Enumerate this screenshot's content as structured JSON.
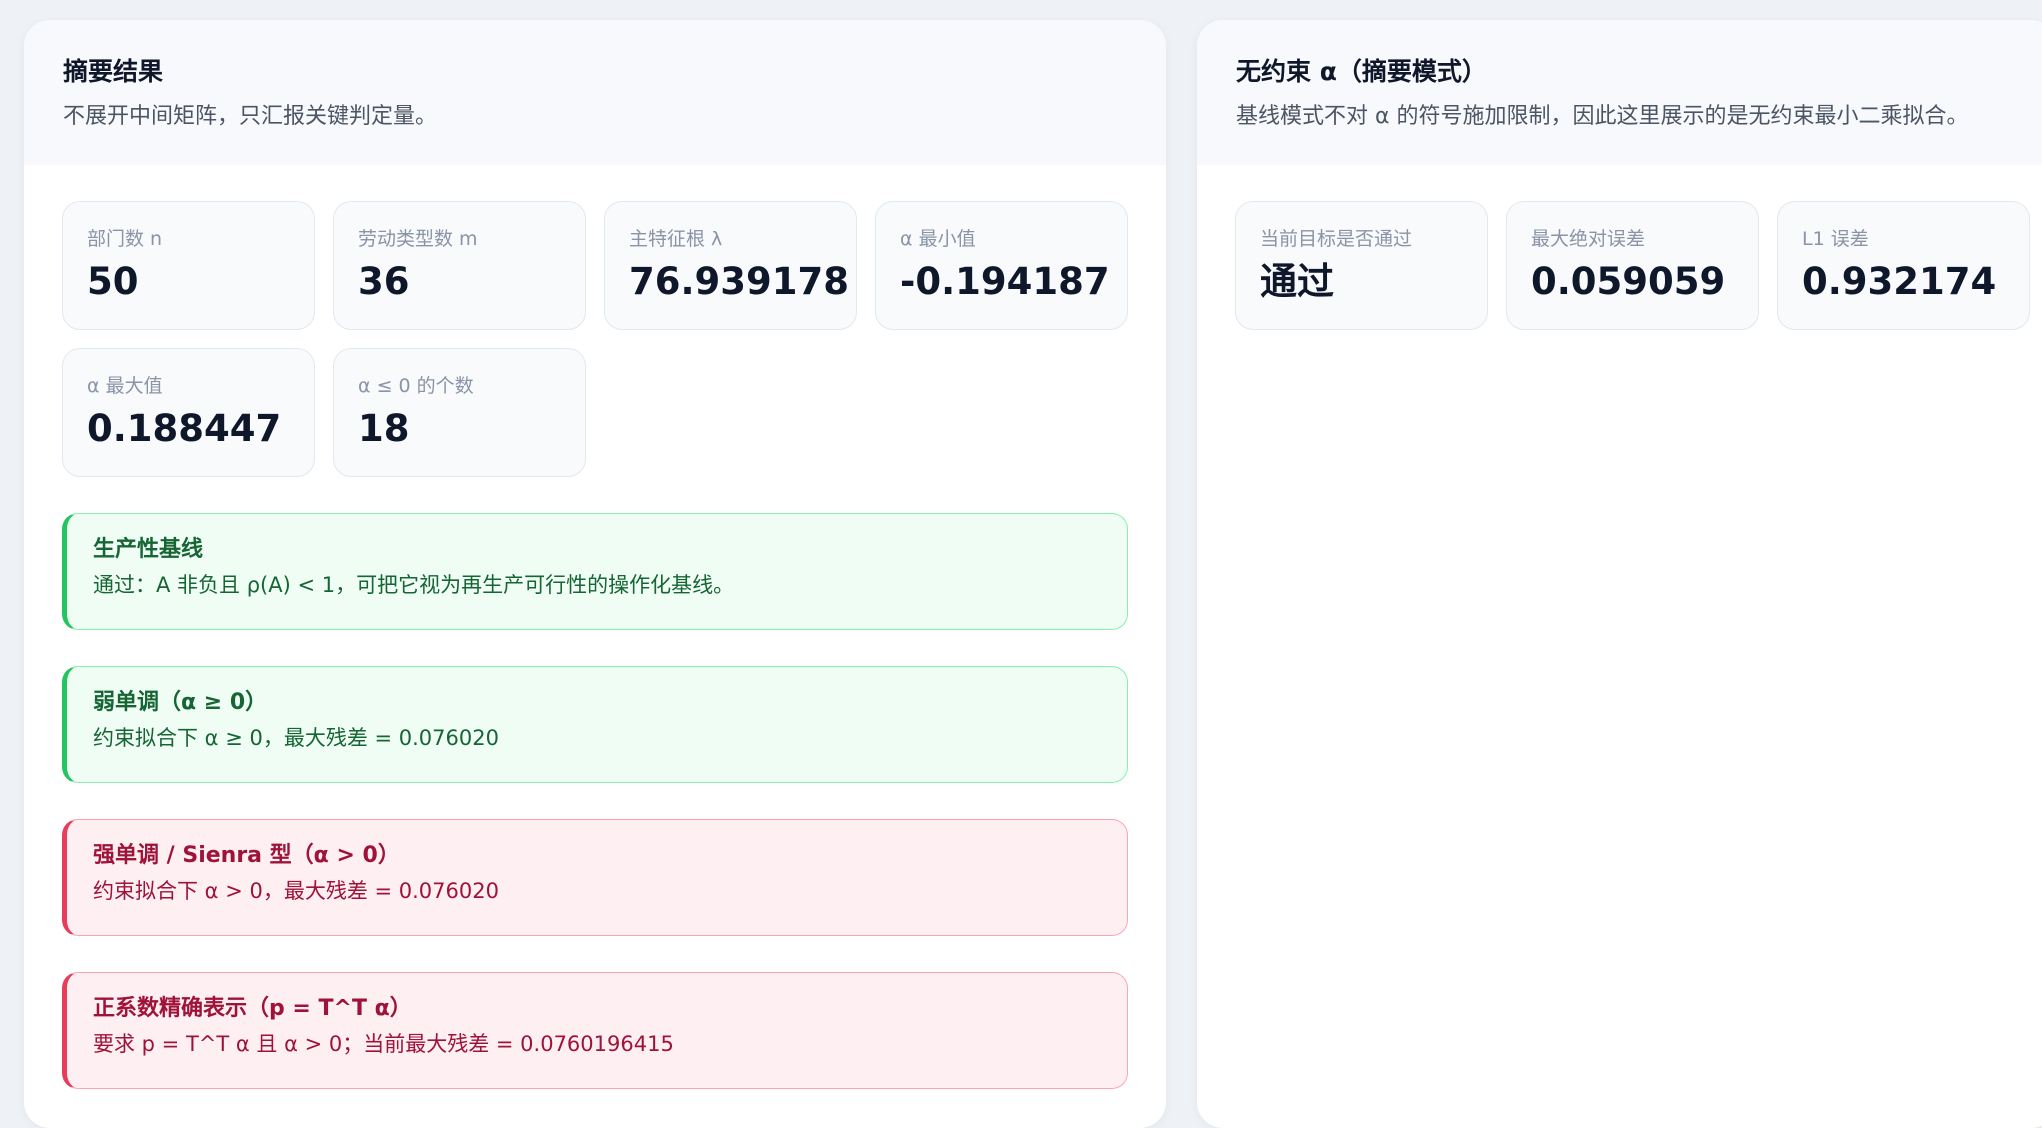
{
  "summary": {
    "title": "摘要结果",
    "subtitle": "不展开中间矩阵，只汇报关键判定量。",
    "stats": [
      {
        "label": "部门数 n",
        "value": "50"
      },
      {
        "label": "劳动类型数 m",
        "value": "36"
      },
      {
        "label": "主特征根 λ",
        "value": "76.939178"
      },
      {
        "label": "α 最小值",
        "value": "-0.194187"
      },
      {
        "label": "α 最大值",
        "value": "0.188447"
      },
      {
        "label": "α ≤ 0 的个数",
        "value": "18"
      }
    ],
    "checks": [
      {
        "status": "success",
        "title": "生产性基线",
        "text": "通过：A 非负且 ρ(A) < 1，可把它视为再生产可行性的操作化基线。"
      },
      {
        "status": "success",
        "title": "弱单调（α ≥ 0）",
        "text": "约束拟合下 α ≥ 0，最大残差 = 0.076020"
      },
      {
        "status": "danger",
        "title": "强单调 / Sienra 型（α > 0）",
        "text": "约束拟合下 α > 0，最大残差 = 0.076020"
      },
      {
        "status": "danger",
        "title": "正系数精确表示（p = T^T α）",
        "text": "要求 p = T^T α 且 α > 0；当前最大残差 = 0.0760196415"
      }
    ]
  },
  "unconstrained": {
    "title": "无约束 α（摘要模式）",
    "subtitle": "基线模式不对 α 的符号施加限制，因此这里展示的是无约束最小二乘拟合。",
    "stats": [
      {
        "label": "当前目标是否通过",
        "value": "通过"
      },
      {
        "label": "最大绝对误差",
        "value": "0.059059"
      },
      {
        "label": "L1 误差",
        "value": "0.932174"
      }
    ]
  },
  "colors": {
    "success_bg": "#effdf4",
    "success_accent": "#22c55e",
    "danger_bg": "#fef0f2",
    "danger_accent": "#e63e5a"
  }
}
